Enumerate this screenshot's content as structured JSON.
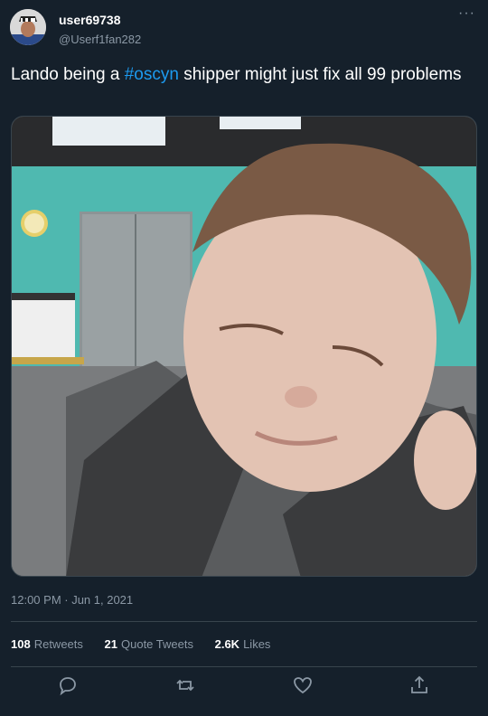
{
  "author": {
    "username": "user69738",
    "handle": "@Userf1fan282"
  },
  "tweet": {
    "text_before": "Lando being a ",
    "hashtag": "#oscyn",
    "text_after": " shipper might just fix all 99 problems",
    "timestamp": "12:00 PM · Jun 1, 2021"
  },
  "stats": {
    "retweets_count": "108",
    "retweets_label": "Retweets",
    "quotes_count": "21",
    "quotes_label": "Quote Tweets",
    "likes_count": "2.6K",
    "likes_label": "Likes"
  },
  "actions": [
    "reply-icon",
    "retweet-icon",
    "like-icon",
    "share-icon"
  ],
  "colors": {
    "background": "#15202b",
    "accent": "#1d9bf0",
    "muted": "#8b98a5",
    "border": "#38444d"
  }
}
